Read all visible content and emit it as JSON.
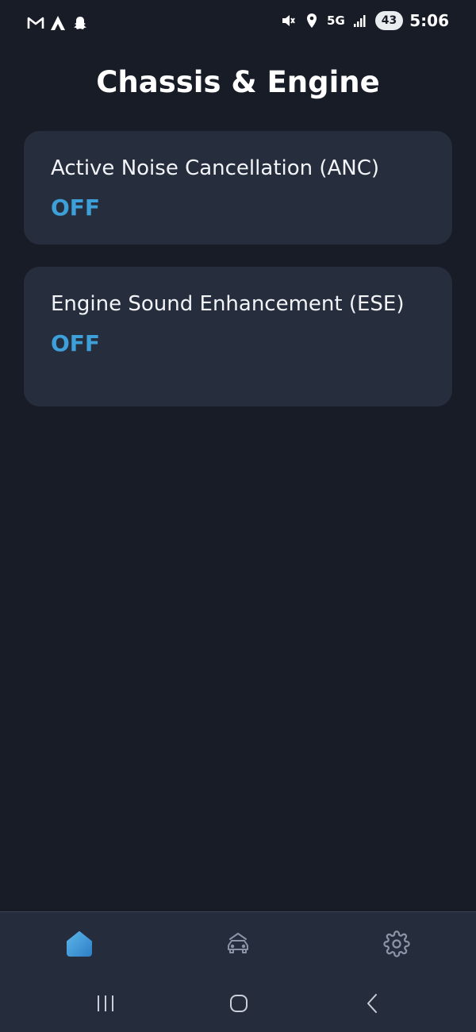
{
  "status_bar": {
    "left_icons": [
      "gmail-icon",
      "app-a-icon",
      "snapchat-icon"
    ],
    "right_icons": [
      "mute-icon",
      "location-icon",
      "signal-icon"
    ],
    "network": "5G",
    "battery": "43",
    "time": "5:06"
  },
  "page": {
    "title": "Chassis & Engine"
  },
  "settings": [
    {
      "label": "Active Noise Cancellation (ANC)",
      "value": "OFF"
    },
    {
      "label": "Engine Sound Enhancement (ESE)",
      "value": "OFF"
    }
  ],
  "bottom_nav": {
    "items": [
      {
        "icon": "home-icon",
        "active": true
      },
      {
        "icon": "car-icon",
        "active": false
      },
      {
        "icon": "gear-icon",
        "active": false
      }
    ]
  },
  "system_nav": [
    "recents-icon",
    "home-circle-icon",
    "back-icon"
  ],
  "colors": {
    "background": "#181c26",
    "card": "#262d3d",
    "accent": "#3da0d8",
    "nav_bar": "#252c3b"
  }
}
